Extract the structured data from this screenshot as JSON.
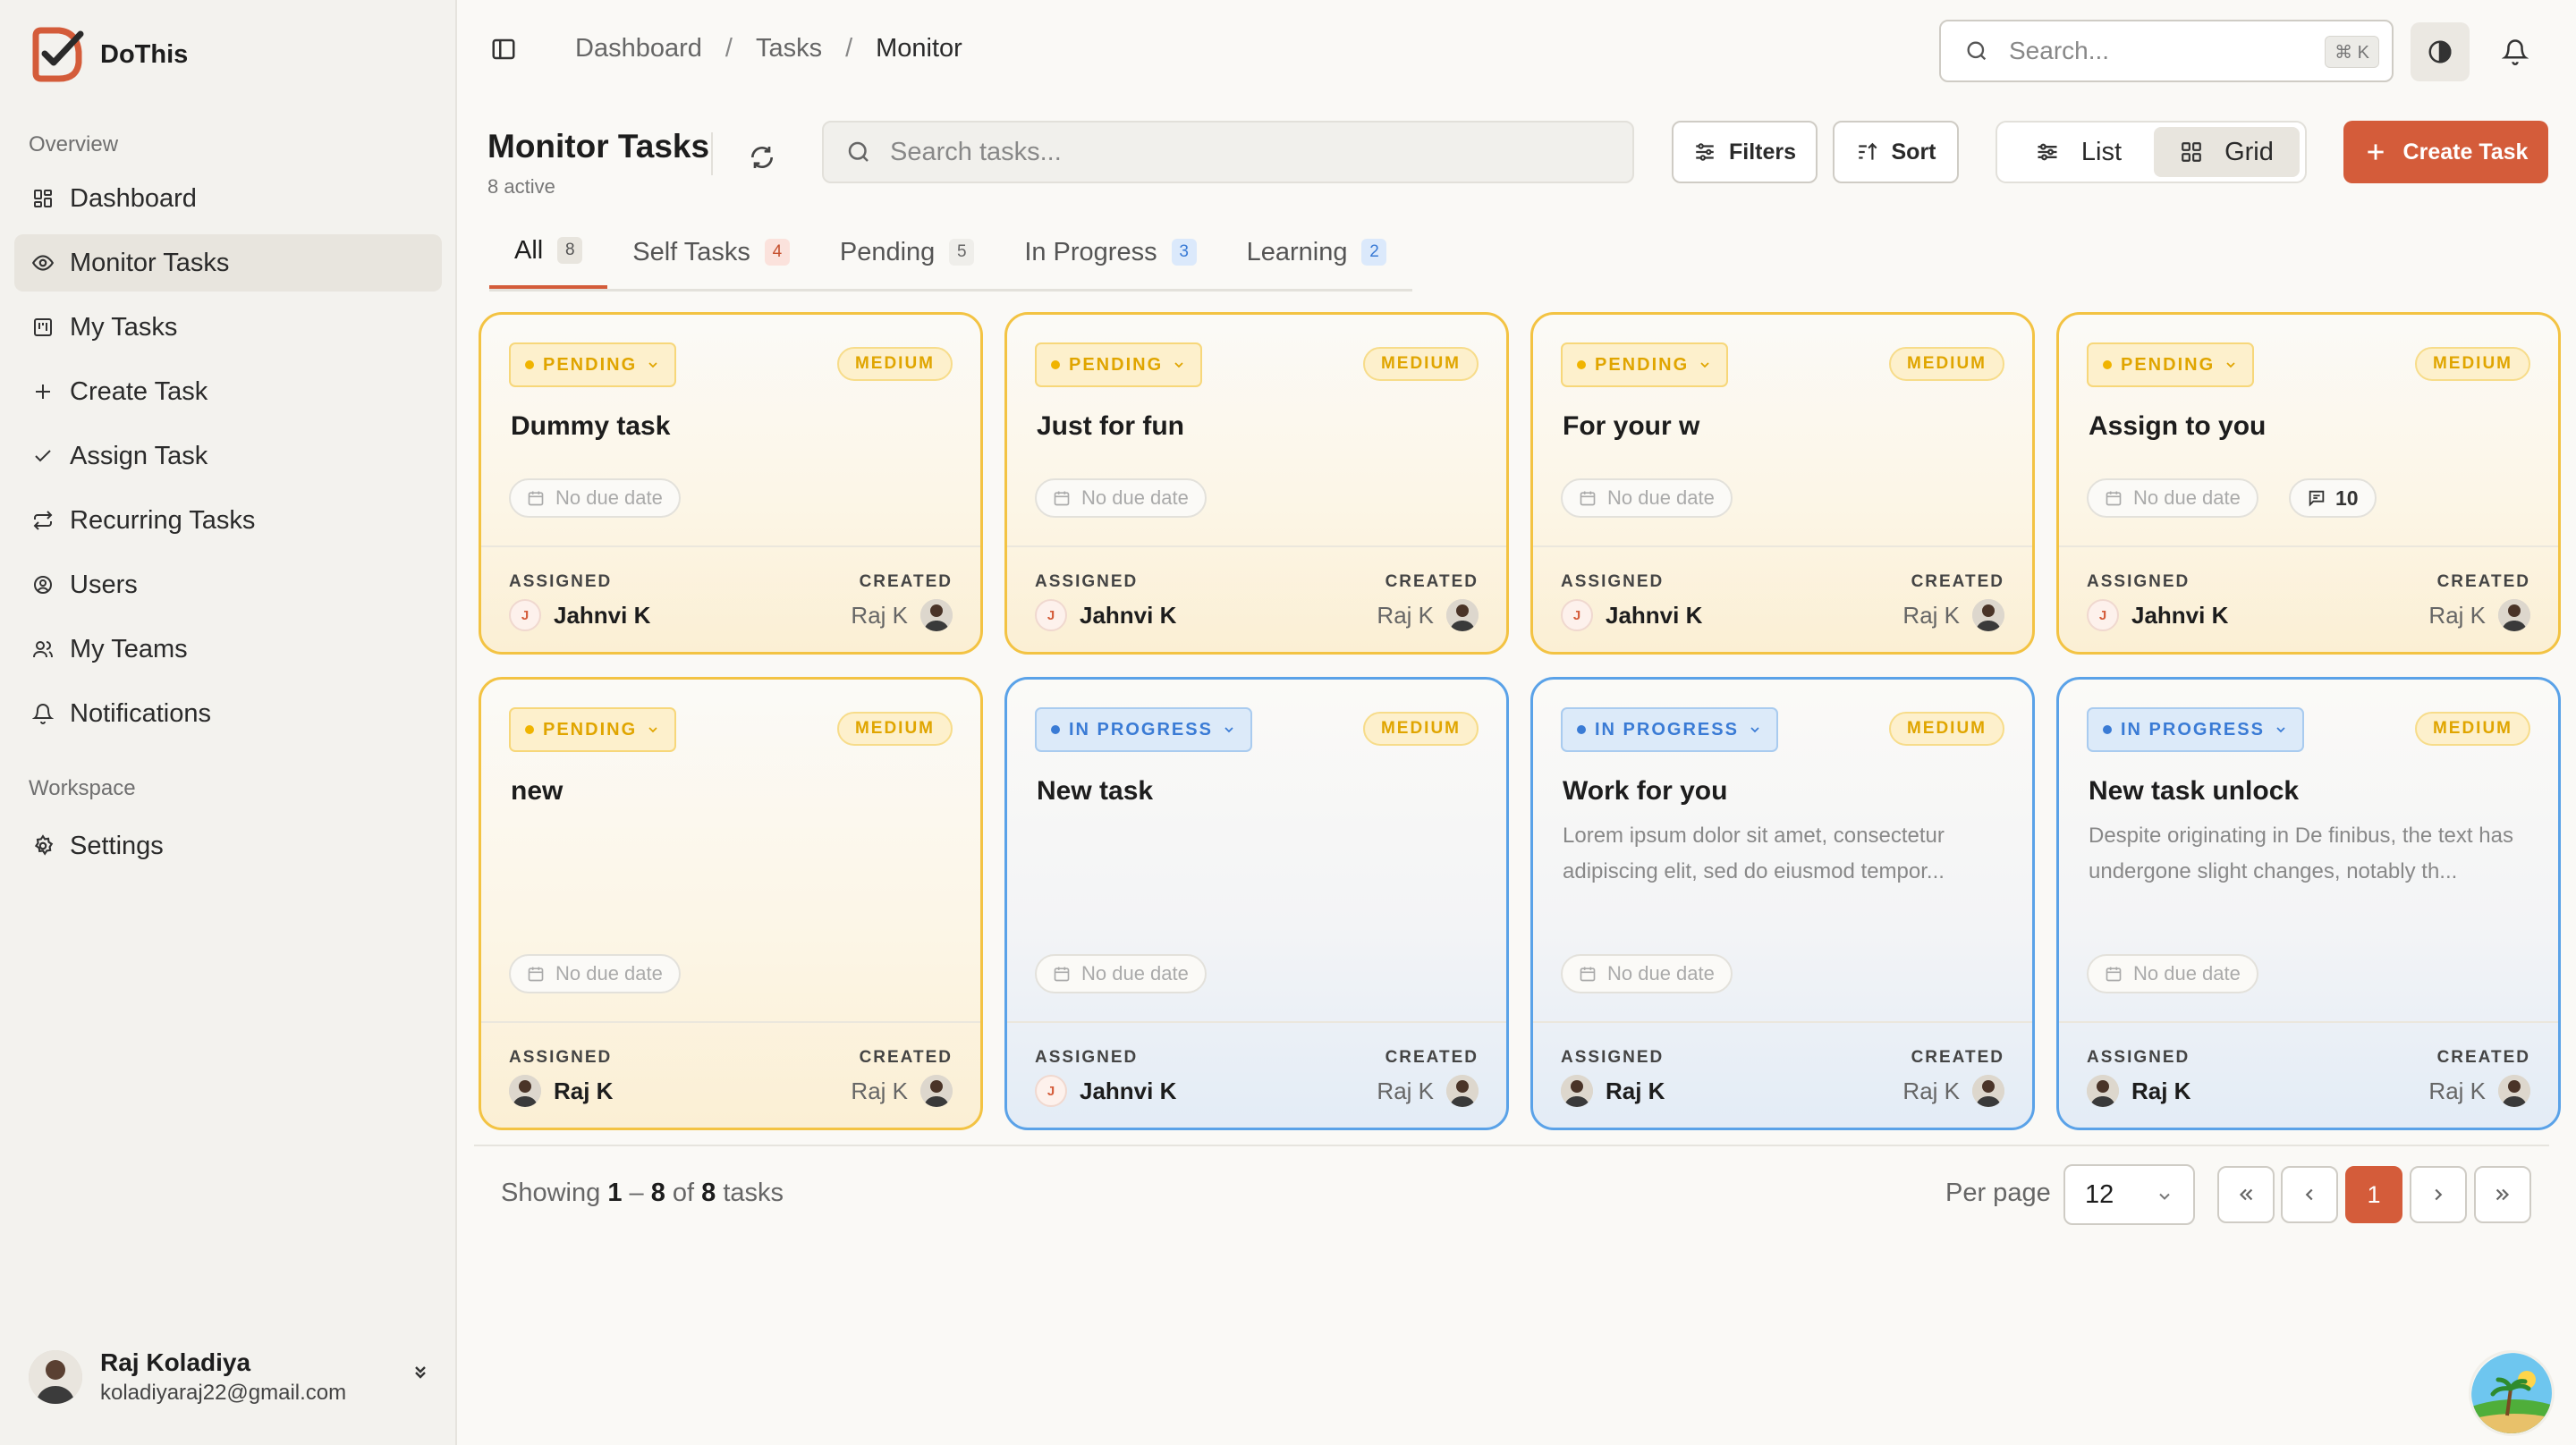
{
  "app": {
    "name": "DoThis"
  },
  "sidebar": {
    "overview_label": "Overview",
    "workspace_label": "Workspace",
    "items": [
      {
        "label": "Dashboard",
        "icon": "layout-grid-icon"
      },
      {
        "label": "Monitor Tasks",
        "icon": "eye-icon",
        "active": true
      },
      {
        "label": "My Tasks",
        "icon": "kanban-icon"
      },
      {
        "label": "Create Task",
        "icon": "plus-icon"
      },
      {
        "label": "Assign Task",
        "icon": "check-icon"
      },
      {
        "label": "Recurring Tasks",
        "icon": "repeat-icon"
      },
      {
        "label": "Users",
        "icon": "user-circle-icon"
      },
      {
        "label": "My Teams",
        "icon": "users-icon"
      },
      {
        "label": "Notifications",
        "icon": "bell-icon"
      }
    ],
    "workspace_items": [
      {
        "label": "Settings",
        "icon": "gear-icon"
      }
    ],
    "user": {
      "name": "Raj Koladiya",
      "email": "koladiyaraj22@gmail.com"
    }
  },
  "topbar": {
    "breadcrumbs": [
      "Dashboard",
      "Tasks",
      "Monitor"
    ],
    "search_placeholder": "Search...",
    "shortcut": "⌘ K"
  },
  "header": {
    "title": "Monitor Tasks",
    "subtitle": "8 active",
    "search_placeholder": "Search tasks...",
    "filters_label": "Filters",
    "sort_label": "Sort",
    "view_list": "List",
    "view_grid": "Grid",
    "active_view": "Grid",
    "create_label": "Create Task"
  },
  "tabs": [
    {
      "label": "All",
      "count": "8",
      "active": true
    },
    {
      "label": "Self Tasks",
      "count": "4"
    },
    {
      "label": "Pending",
      "count": "5"
    },
    {
      "label": "In Progress",
      "count": "3"
    },
    {
      "label": "Learning",
      "count": "2"
    }
  ],
  "card_labels": {
    "assigned": "ASSIGNED",
    "created": "CREATED",
    "no_due": "No due date"
  },
  "tasks": [
    {
      "status": "PENDING",
      "priority": "MEDIUM",
      "title": "Dummy task",
      "description": "",
      "assigned": "Jahnvi K",
      "assigned_initial": "J",
      "created": "Raj K"
    },
    {
      "status": "PENDING",
      "priority": "MEDIUM",
      "title": "Just for fun",
      "description": "",
      "assigned": "Jahnvi K",
      "assigned_initial": "J",
      "created": "Raj K"
    },
    {
      "status": "PENDING",
      "priority": "MEDIUM",
      "title": "For your w",
      "description": "",
      "assigned": "Jahnvi K",
      "assigned_initial": "J",
      "created": "Raj K"
    },
    {
      "status": "PENDING",
      "priority": "MEDIUM",
      "title": "Assign to you",
      "description": "",
      "comments": "10",
      "assigned": "Jahnvi K",
      "assigned_initial": "J",
      "created": "Raj K"
    },
    {
      "status": "PENDING",
      "priority": "MEDIUM",
      "title": "new",
      "description": "",
      "assigned": "Raj K",
      "created": "Raj K"
    },
    {
      "status": "IN PROGRESS",
      "priority": "MEDIUM",
      "title": "New task",
      "description": "",
      "assigned": "Jahnvi K",
      "assigned_initial": "J",
      "created": "Raj K"
    },
    {
      "status": "IN PROGRESS",
      "priority": "MEDIUM",
      "title": "Work for you",
      "description": "Lorem ipsum dolor sit amet, consectetur adipiscing elit, sed do eiusmod tempor...",
      "assigned": "Raj K",
      "created": "Raj K"
    },
    {
      "status": "IN PROGRESS",
      "priority": "MEDIUM",
      "title": "New task unlock",
      "description": "Despite originating in De finibus, the text has undergone slight changes, notably th...",
      "assigned": "Raj K",
      "created": "Raj K"
    }
  ],
  "pagination": {
    "showing_prefix": "Showing",
    "range_start": "1",
    "dash": "–",
    "range_end": "8",
    "of": "of",
    "total": "8",
    "suffix": "tasks",
    "per_page_label": "Per page",
    "per_page": "12",
    "current_page": "1"
  },
  "colors": {
    "accent": "#d45c3a",
    "pending": "#f3c343",
    "in_progress": "#5aa2e8"
  }
}
